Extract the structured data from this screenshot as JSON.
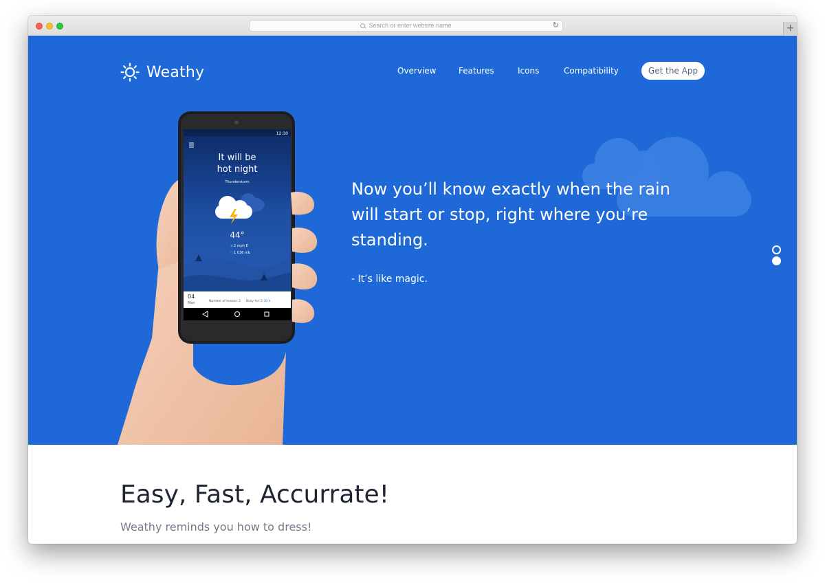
{
  "browser": {
    "address_placeholder": "Search or enter website name",
    "new_tab_label": "+"
  },
  "header": {
    "logo_text": "Weathy",
    "nav": [
      "Overview",
      "Features",
      "Icons",
      "Compatibility"
    ],
    "cta_label": "Get the App"
  },
  "hero": {
    "headline": "Now you’ll know exactly when the rain will start or stop, right where you’re standing.",
    "tagline": "- It’s like magic.",
    "slider_dots": 2,
    "active_dot": 2
  },
  "phone": {
    "status_time": "12:30",
    "forecast_line1": "It will be",
    "forecast_line2": "hot night",
    "condition": "Thunderstorm",
    "temperature": "44°",
    "wind": "2 mph E",
    "pressure": "1 036 mb",
    "date_day": "04",
    "date_weekday": "Mon",
    "events_label": "Number of events:",
    "events_value": "3",
    "busy_label": "Busy for:",
    "busy_value": "2:30 h"
  },
  "section2": {
    "title": "Easy, Fast, Accurrate!",
    "subtitle": "Weathy reminds you how to dress!"
  },
  "colors": {
    "hero_bg": "#1e69d7",
    "cloud": "#3d83e3",
    "cta_text": "#55657a",
    "title_text": "#1f2533",
    "subtitle_text": "#717b8a"
  }
}
